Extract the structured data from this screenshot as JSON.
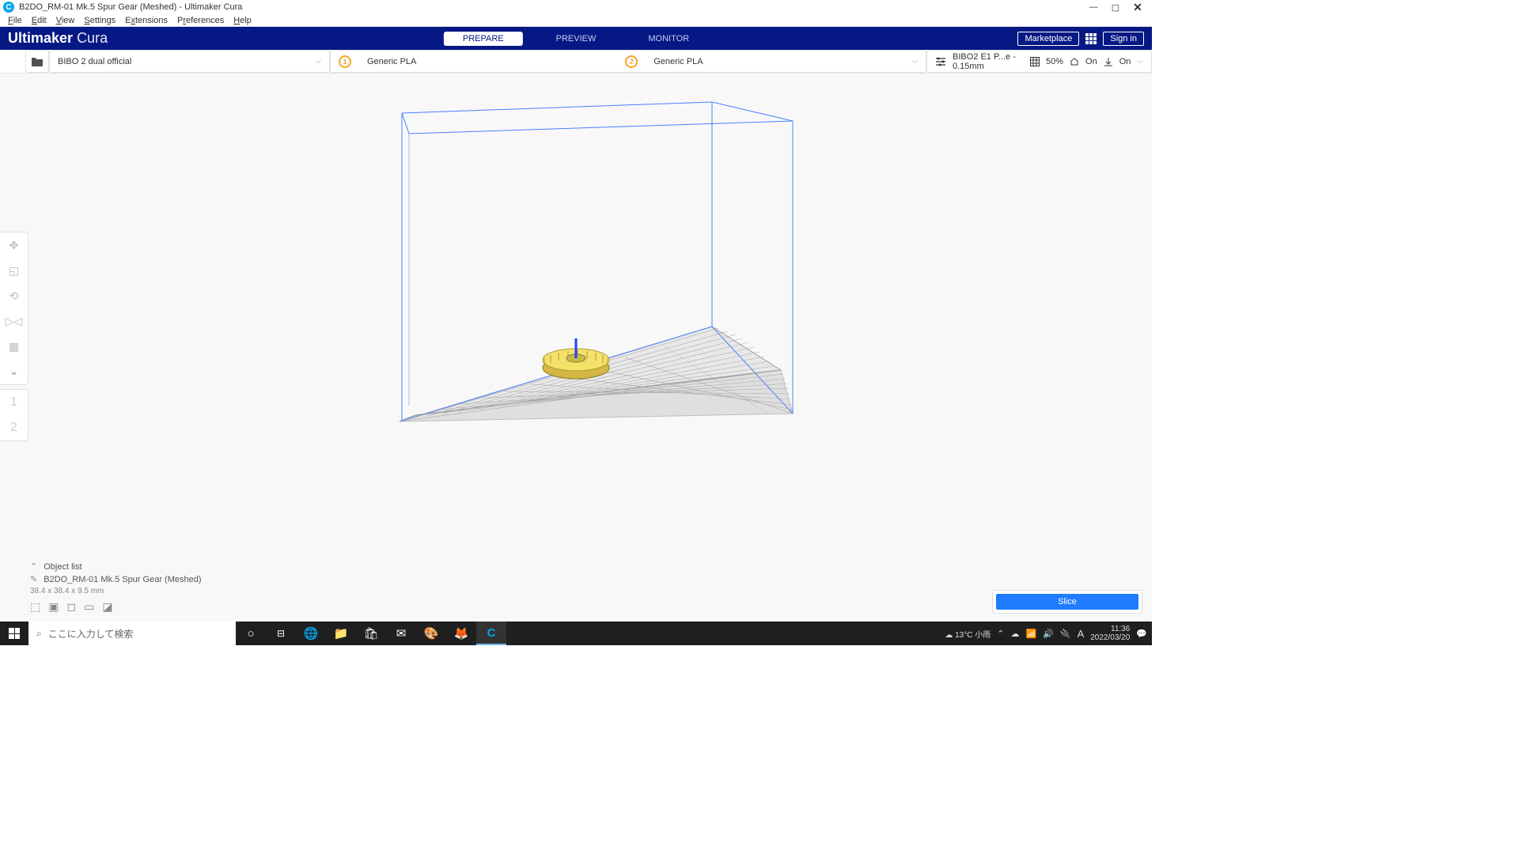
{
  "titlebar": {
    "title": "B2DO_RM-01 Mk.5 Spur Gear (Meshed) - Ultimaker Cura"
  },
  "menubar": [
    "File",
    "Edit",
    "View",
    "Settings",
    "Extensions",
    "Preferences",
    "Help"
  ],
  "brand": {
    "name": "Ultimaker",
    "product": "Cura"
  },
  "tabs": {
    "prepare": "PREPARE",
    "preview": "PREVIEW",
    "monitor": "MONITOR"
  },
  "header_right": {
    "marketplace": "Marketplace",
    "signin": "Sign in"
  },
  "config": {
    "printer": "BIBO 2 dual official",
    "extruder1": {
      "num": "1",
      "material": "Generic PLA"
    },
    "extruder2": {
      "num": "2",
      "material": "Generic PLA"
    },
    "settings": {
      "profile": "BIBO2 E1 P...e - 0.15mm",
      "infill": "50%",
      "support": "On",
      "adhesion": "On"
    }
  },
  "object_list": {
    "title": "Object list",
    "object_name": "B2DO_RM-01 Mk.5 Spur Gear (Meshed)",
    "dimensions": "38.4 x 38.4 x 9.5 mm"
  },
  "slice": {
    "label": "Slice"
  },
  "taskbar": {
    "search_placeholder": "ここに入力して検索",
    "weather": "13°C 小雨",
    "ime": "A",
    "time": "11:36",
    "date": "2022/03/20"
  }
}
